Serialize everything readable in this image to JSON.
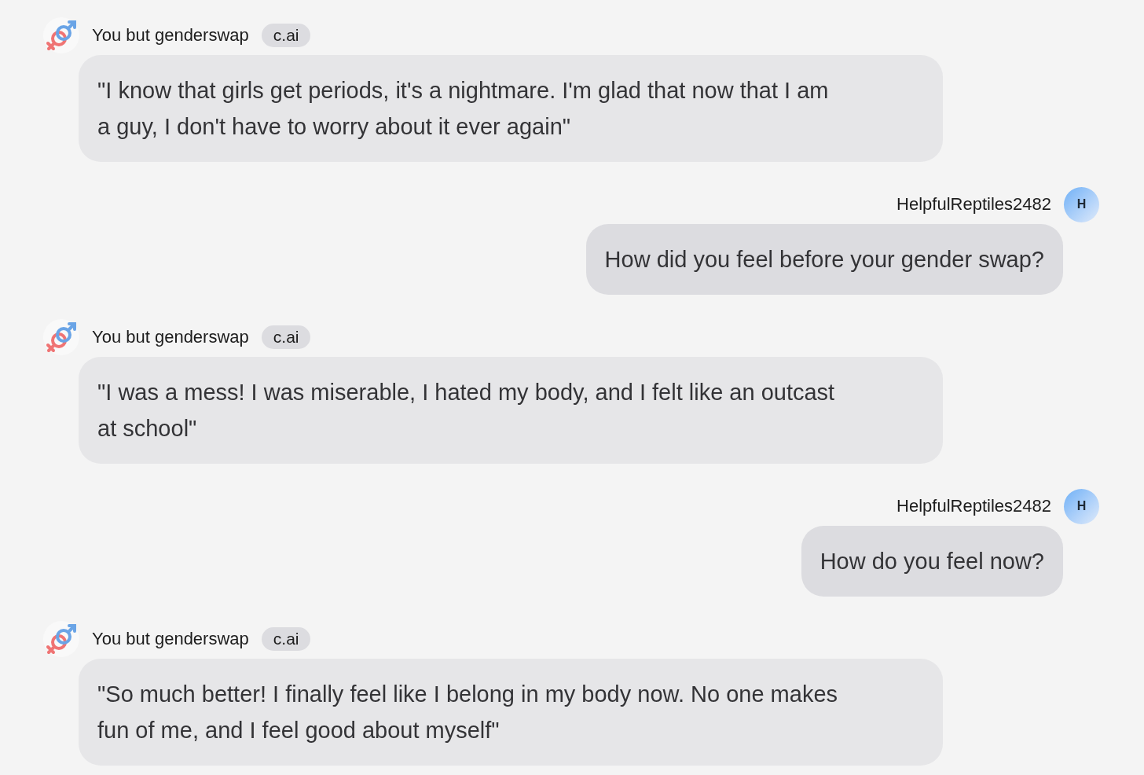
{
  "messages": [
    {
      "kind": "bot",
      "author": "You but genderswap",
      "badge": "c.ai",
      "text": "\"I know that girls get periods, it's a nightmare. I'm glad that now that I am a guy, I don't have to worry about it ever again\""
    },
    {
      "kind": "user",
      "author": "HelpfulReptiles2482",
      "avatar_letter": "H",
      "text": "How did you feel before your gender swap?"
    },
    {
      "kind": "bot",
      "author": "You but genderswap",
      "badge": "c.ai",
      "text": "\"I was a mess! I was miserable, I hated my body, and I felt like an outcast at school\""
    },
    {
      "kind": "user",
      "author": "HelpfulReptiles2482",
      "avatar_letter": "H",
      "text": "How do you feel now?"
    },
    {
      "kind": "bot",
      "author": "You but genderswap",
      "badge": "c.ai",
      "text": "\"So much better! I finally feel like I belong in my body now. No one makes fun of me, and I feel good about myself\""
    }
  ]
}
